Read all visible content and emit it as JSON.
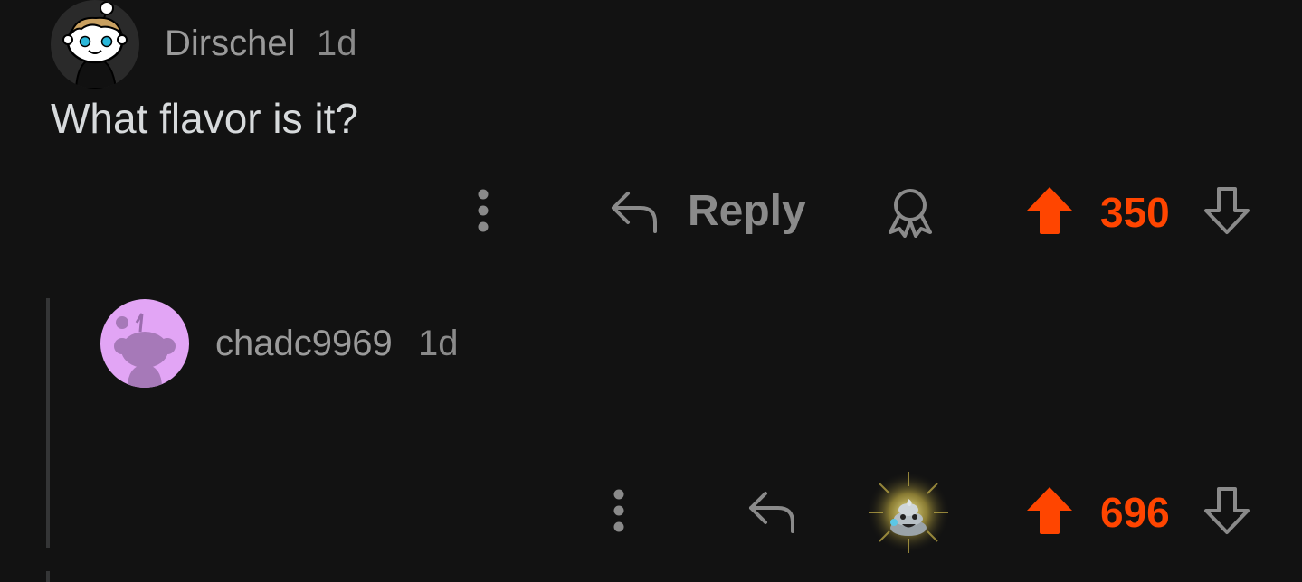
{
  "comments": [
    {
      "username": "Dirschel",
      "time": "1d",
      "body": "What flavor is it?",
      "reply_label": "Reply",
      "score": "350"
    },
    {
      "username": "chadc9969",
      "time": "1d",
      "score": "696"
    }
  ],
  "icons": {
    "more": "more-vertical-icon",
    "reply": "reply-arrow-icon",
    "award": "award-icon",
    "award_given": "poop-award-icon",
    "upvote": "upvote-arrow-icon",
    "downvote": "downvote-arrow-icon"
  },
  "colors": {
    "background": "#121212",
    "upvote_active": "#ff4500",
    "muted_text": "#8a8a8a",
    "body_text": "#d7dadc",
    "avatar2_bg": "#e2a5f5"
  }
}
